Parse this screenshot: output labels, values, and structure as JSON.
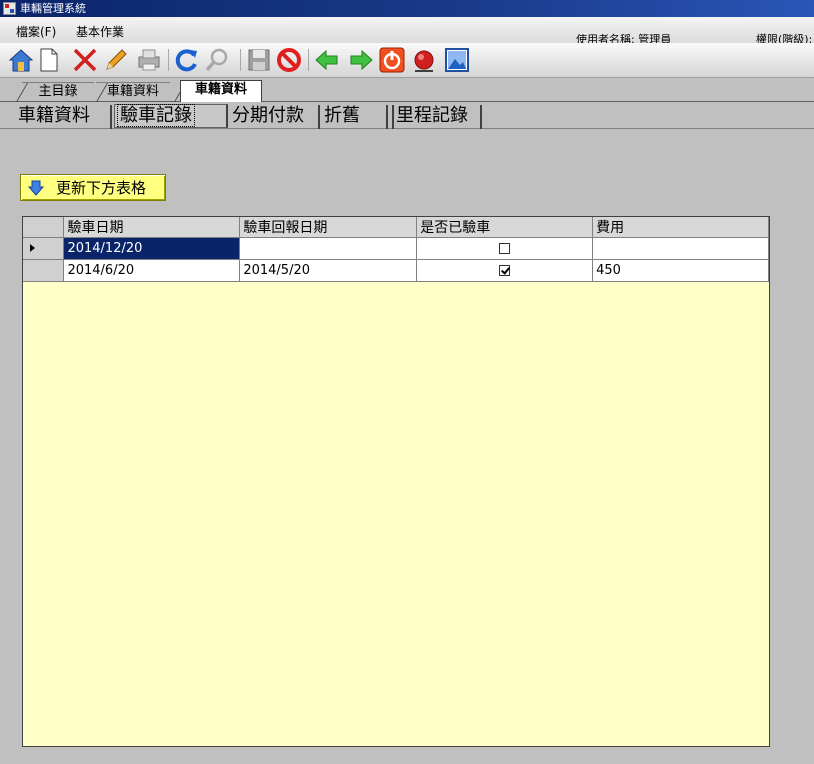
{
  "window": {
    "title": "車輛管理系統"
  },
  "menu": {
    "items": [
      {
        "label": "檔案(F)"
      },
      {
        "label": "基本作業"
      }
    ],
    "user_label": "使用者名稱: 管理員",
    "permission_label": "權限(階級):"
  },
  "toolbar": {
    "icons": [
      "home-icon",
      "new-document-icon",
      "delete-icon",
      "edit-pencil-icon",
      "print-icon",
      "refresh-icon",
      "search-icon",
      "save-icon",
      "cancel-icon",
      "previous-icon",
      "next-icon",
      "power-icon",
      "alarm-icon",
      "image-icon"
    ]
  },
  "nav_tabs": [
    {
      "label": "主目錄",
      "active": false
    },
    {
      "label": "車籍資料",
      "active": false
    },
    {
      "label": "車籍資料",
      "active": true
    }
  ],
  "sub_tabs": [
    {
      "label": "車籍資料",
      "active": false
    },
    {
      "label": "驗車記錄",
      "active": true
    },
    {
      "label": "分期付款",
      "active": false
    },
    {
      "label": "折舊",
      "active": false
    },
    {
      "label": "里程記錄",
      "active": false
    }
  ],
  "refresh_button": {
    "label": "更新下方表格"
  },
  "grid": {
    "columns": [
      "驗車日期",
      "驗車回報日期",
      "是否已驗車",
      "費用"
    ],
    "rows": [
      {
        "inspection_date": "2014/12/20",
        "report_date": "",
        "inspected": false,
        "fee": "",
        "current": true
      },
      {
        "inspection_date": "2014/6/20",
        "report_date": "2014/5/20",
        "inspected": true,
        "fee": "450",
        "current": false
      }
    ],
    "background_color": "#ffffc8",
    "selection_color": "#0a246a"
  }
}
